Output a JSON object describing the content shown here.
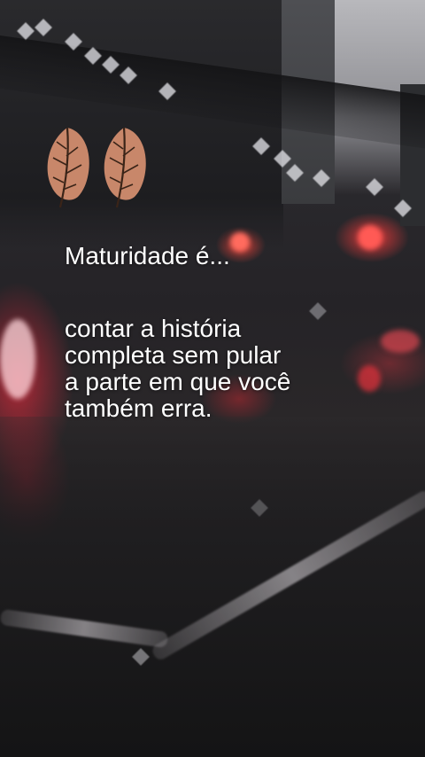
{
  "quote": {
    "title": "Maturidade é...",
    "lines": [
      "contar a história",
      "completa sem pular",
      "a parte em que você",
      "também erra."
    ]
  },
  "decoration": {
    "leaf_icon_count": 2,
    "leaf_color": "#c8876a",
    "leaf_vein_color": "#3a2418"
  },
  "background": {
    "scene": "rainy-city-street-bokeh",
    "accent_red": "#ff3c3c"
  }
}
